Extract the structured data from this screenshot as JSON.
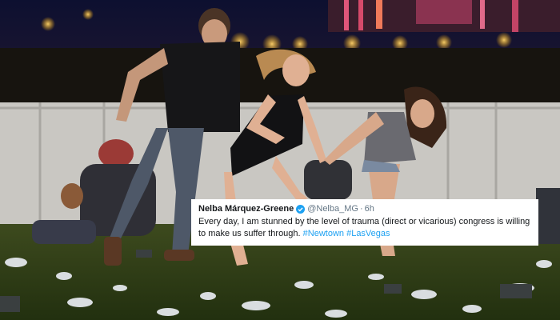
{
  "tweet": {
    "author_name": "Nelba Márquez-Greene",
    "author_handle": "@Nelba_MG",
    "separator": "·",
    "timestamp": "6h",
    "text": "Every day, I am stunned by the level of trauma (direct or vicarious) congress is willing to make us suffer through.",
    "hashtags": [
      "#Newtown",
      "#LasVegas"
    ],
    "colors": {
      "hashtag": "#1da1f2",
      "verified": "#1da1f2",
      "handle": "#657786"
    }
  },
  "photo": {
    "icons": [
      "verified-badge-icon"
    ]
  }
}
